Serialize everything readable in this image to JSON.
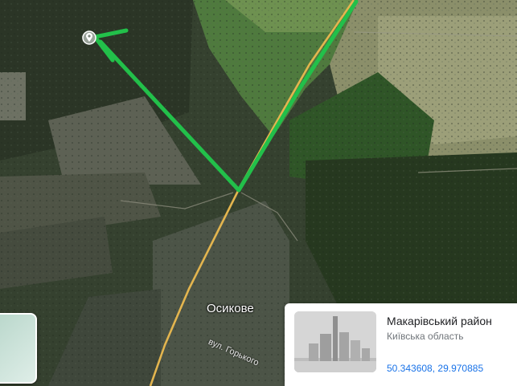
{
  "map": {
    "place_label": "Осикове",
    "street_label": "вул. Горького",
    "route_color": "#22c04a",
    "road_color": "#e3b54f",
    "marker_icon": "location-pin-icon"
  },
  "info_card": {
    "title": "Макарівський район",
    "subtitle": "Київська область",
    "coordinates": "50.343608, 29.970885",
    "thumbnail_icon": "city-buildings-icon"
  }
}
